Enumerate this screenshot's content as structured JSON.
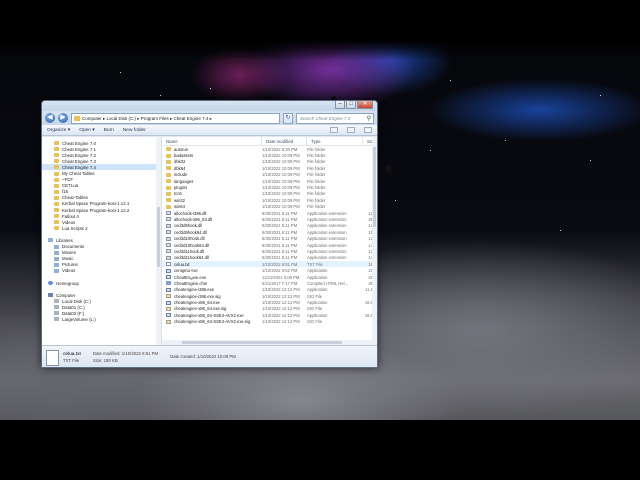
{
  "window": {
    "address_path": "Computer  ▸  Local Disk (C:)  ▸  Program Files  ▸  Cheat Engine 7.4  ▸",
    "search_placeholder": "Search Cheat Engine 7.4",
    "controls": {
      "minimize": "‒",
      "maximize": "□",
      "close": "✕"
    }
  },
  "toolbar": {
    "organize": "Organize ▾",
    "open": "Open ▾",
    "burn": "Burn",
    "new_folder": "New folder"
  },
  "navpane": {
    "items": [
      {
        "label": "Cheat Engine 7.0",
        "icon": "folder-icon"
      },
      {
        "label": "Cheat Engine 7.1",
        "icon": "folder-icon"
      },
      {
        "label": "Cheat Engine 7.2",
        "icon": "folder-icon"
      },
      {
        "label": "Cheat Engine 7.3",
        "icon": "folder-icon"
      },
      {
        "label": "Cheat Engine 7.4",
        "icon": "folder-icon",
        "selected": true
      },
      {
        "label": "My Cheat Tables",
        "icon": "folder-icon"
      },
      {
        "label": "~FCF",
        "icon": "folder-icon"
      },
      {
        "label": "CETLua",
        "icon": "folder-icon"
      },
      {
        "label": "f16",
        "icon": "folder-icon"
      },
      {
        "label": "Cheat-Tables",
        "icon": "folder-icon"
      },
      {
        "label": "Kerbal Space Program-kosi-1.12.1",
        "icon": "folder-icon"
      },
      {
        "label": "Kerbal Space Program-kosi-1.12.2",
        "icon": "folder-icon"
      },
      {
        "label": "Fallout 4",
        "icon": "folder-icon"
      },
      {
        "label": "Videos",
        "icon": "folder-icon"
      },
      {
        "label": "Lua Scripts 2",
        "icon": "folder-icon"
      }
    ],
    "libraries": {
      "label": "Libraries",
      "items": [
        "Documents",
        "Movies",
        "Music",
        "Pictures",
        "Videos"
      ]
    },
    "homegroup": "Homegroup",
    "computer": {
      "label": "Computer",
      "items": [
        "Local Disk (C:)",
        "Data01 (C:)",
        "Data02 (F:)",
        "LargeVolume (L:)"
      ]
    }
  },
  "filelist": {
    "columns": {
      "name": "Name",
      "date": "Date modified",
      "type": "Type",
      "size": "Size"
    },
    "rows": [
      {
        "name": "autorun",
        "date": "1/10/2022 8:30 PM",
        "type": "File folder",
        "size": "",
        "kind": "folder"
      },
      {
        "name": "badassets",
        "date": "1/10/2022 10:09 PM",
        "type": "File folder",
        "size": "",
        "kind": "folder"
      },
      {
        "name": "dbk32",
        "date": "1/10/2022 10:09 PM",
        "type": "File folder",
        "size": "",
        "kind": "folder"
      },
      {
        "name": "dbk64",
        "date": "1/10/2022 10:09 PM",
        "type": "File folder",
        "size": "",
        "kind": "folder"
      },
      {
        "name": "include",
        "date": "1/10/2022 10:09 PM",
        "type": "File folder",
        "size": "",
        "kind": "folder"
      },
      {
        "name": "languages",
        "date": "1/10/2022 10:09 PM",
        "type": "File folder",
        "size": "",
        "kind": "folder"
      },
      {
        "name": "plugins",
        "date": "1/10/2022 10:09 PM",
        "type": "File folder",
        "size": "",
        "kind": "folder"
      },
      {
        "name": "tcc6",
        "date": "1/10/2022 10:09 PM",
        "type": "File folder",
        "size": "",
        "kind": "folder"
      },
      {
        "name": "win32",
        "date": "1/10/2022 10:09 PM",
        "type": "File folder",
        "size": "",
        "kind": "folder"
      },
      {
        "name": "win64",
        "date": "1/10/2022 10:09 PM",
        "type": "File folder",
        "size": "",
        "kind": "folder"
      },
      {
        "name": "allochook-i386.dll",
        "date": "6/30/2021 6:11 PM",
        "type": "Application extension",
        "size": "12",
        "kind": "dll"
      },
      {
        "name": "allochook-x86_64.dll",
        "date": "6/30/2021 6:11 PM",
        "type": "Application extension",
        "size": "45",
        "kind": "dll"
      },
      {
        "name": "ced3d9hook.dll",
        "date": "6/30/2021 6:11 PM",
        "type": "Application extension",
        "size": "13",
        "kind": "dll"
      },
      {
        "name": "ced3d9hook64.dll",
        "date": "6/30/2021 6:11 PM",
        "type": "Application extension",
        "size": "15",
        "kind": "dll"
      },
      {
        "name": "ced3d10hook.dll",
        "date": "6/30/2021 6:11 PM",
        "type": "Application extension",
        "size": "13",
        "kind": "dll"
      },
      {
        "name": "ced3d10hook64.dll",
        "date": "6/30/2021 6:11 PM",
        "type": "Application extension",
        "size": "14",
        "kind": "dll"
      },
      {
        "name": "ced3d11hook.dll",
        "date": "6/30/2021 6:11 PM",
        "type": "Application extension",
        "size": "13",
        "kind": "dll"
      },
      {
        "name": "ced3d11hook64.dll",
        "date": "6/30/2021 6:11 PM",
        "type": "Application extension",
        "size": "14",
        "kind": "dll"
      },
      {
        "name": "celua.txt",
        "date": "1/10/2022 6:51 PM",
        "type": "TXT File",
        "size": "19",
        "kind": "txt",
        "hover": true
      },
      {
        "name": "cenigma.exe",
        "date": "1/10/2022 9:52 PM",
        "type": "Application",
        "size": "20",
        "kind": "exe"
      },
      {
        "name": "CheatEngine.exe",
        "date": "11/21/2021 3:06 PM",
        "type": "Application",
        "size": "28",
        "kind": "exe"
      },
      {
        "name": "CheatEngine.chm",
        "date": "5/21/2017 7:17 PM",
        "type": "Compiled HTML Hel...",
        "size": "36",
        "kind": "chm"
      },
      {
        "name": "cheatengine-i386.exe",
        "date": "1/10/2022 12:12 PM",
        "type": "Application",
        "size": "11,1",
        "kind": "exe"
      },
      {
        "name": "cheatengine-i386.exe.sig",
        "date": "1/10/2022 12:12 PM",
        "type": "SIG File",
        "size": "",
        "kind": "sig"
      },
      {
        "name": "cheatengine-x86_64.exe",
        "date": "1/10/2022 12:12 PM",
        "type": "Application",
        "size": "16,0",
        "kind": "exe"
      },
      {
        "name": "cheatengine-x86_64.exe.sig",
        "date": "1/10/2022 12:12 PM",
        "type": "SIG File",
        "size": "",
        "kind": "sig"
      },
      {
        "name": "cheatengine-x86_64-SSE4-AVX2.exe",
        "date": "1/10/2022 12:12 PM",
        "type": "Application",
        "size": "16,0",
        "kind": "exe"
      },
      {
        "name": "cheatengine-x86_64-SSE4-AVX2.exe.sig",
        "date": "1/10/2022 12:12 PM",
        "type": "SIG File",
        "size": "",
        "kind": "sig"
      }
    ]
  },
  "details": {
    "filename": "celua.txt",
    "filetype": "TXT File",
    "modified_label": "Date modified:",
    "modified_value": "1/10/2022 6:51 PM",
    "size_label": "Size:",
    "size_value": "190 KB",
    "created_label": "Date created:",
    "created_value": "1/10/2022 10:09 PM"
  }
}
